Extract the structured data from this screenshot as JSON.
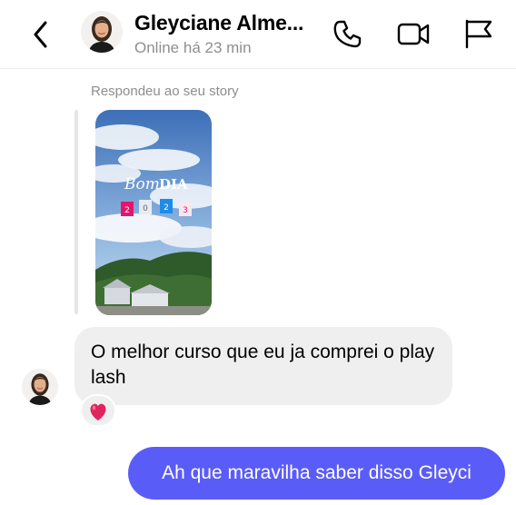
{
  "header": {
    "contact_name": "Gleyciane Alme...",
    "status": "Online há 23 min",
    "icons": {
      "back": "chevron-left-icon",
      "call": "phone-icon",
      "video": "video-camera-icon",
      "report": "flag-icon"
    }
  },
  "story_reply": {
    "caption": "Respondeu ao seu story",
    "story_text": {
      "greeting_a": "Bom",
      "greeting_b": "DIA",
      "year_digits": [
        "2",
        "0",
        "2",
        "3"
      ]
    }
  },
  "messages": [
    {
      "direction": "incoming",
      "text": "O melhor curso que eu ja comprei o play lash",
      "reaction": "❤️"
    },
    {
      "direction": "outgoing",
      "text": "Ah que maravilha saber disso Gleyci"
    }
  ],
  "colors": {
    "outgoing_bubble": "#5a5cf7",
    "incoming_bubble": "#efefef",
    "secondary_text": "#8e8e8e",
    "heart": "#e0245e"
  }
}
